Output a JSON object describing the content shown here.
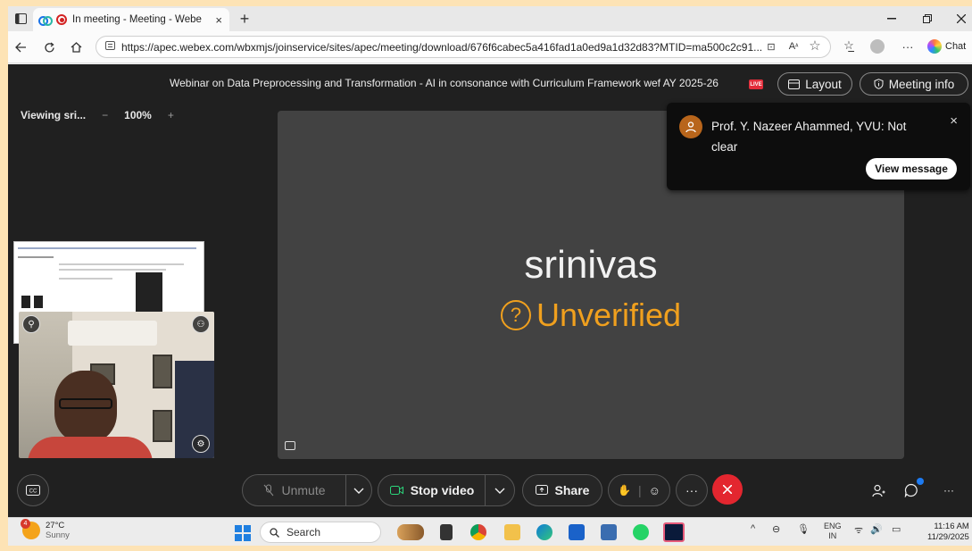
{
  "browser": {
    "tab_title": "In meeting - Meeting - Webe",
    "tab_close": "×",
    "new_tab": "+",
    "url": "https://apec.webex.com/wbxmjs/joinservice/sites/apec/meeting/download/676f6cabec5a416fad1a0ed9a1d32d83?MTID=ma500c2c91...",
    "chat_label": "Chat"
  },
  "meeting": {
    "title": "Webinar on Data Preprocessing and Transformation - AI in consonance with Curriculum Framework wef AY 2025-26",
    "live_badge": "LIVE",
    "layout_label": "Layout",
    "info_label": "Meeting info",
    "viewing_label": "Viewing sri...",
    "zoom_minus": "−",
    "zoom_level": "100%",
    "zoom_plus": "+"
  },
  "stage": {
    "participant_name": "srinivas",
    "status_label": "Unverified",
    "status_icon": "?",
    "status_color": "#f0a01e"
  },
  "notification": {
    "message": "Prof. Y. Nazeer Ahammed, YVU: Not clear",
    "button_label": "View message",
    "close": "×"
  },
  "controls": {
    "unmute_label": "Unmute",
    "stop_video_label": "Stop video",
    "share_label": "Share",
    "more": "···",
    "end_color": "#e3262f"
  },
  "taskbar": {
    "temperature": "27°C",
    "condition": "Sunny",
    "weather_badge": "4",
    "search_label": "Search",
    "lang_top": "ENG",
    "lang_bottom": "IN",
    "time": "11:16 AM",
    "date": "11/29/2025"
  }
}
